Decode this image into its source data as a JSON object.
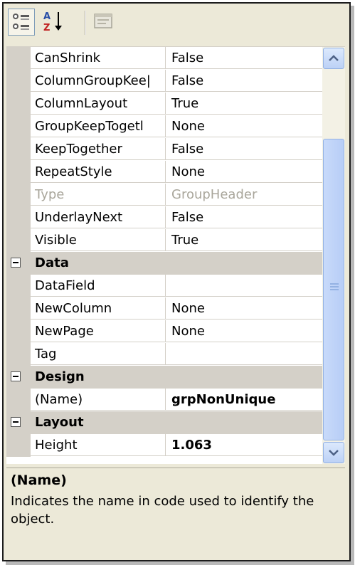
{
  "toolbar": {
    "categorized_icon": "categorized-icon",
    "alphabetical_icon": "alphabetical-sort-icon",
    "property_pages_icon": "property-pages-icon"
  },
  "rows_top": [
    {
      "name": "CanShrink",
      "value": "False"
    },
    {
      "name": "ColumnGroupKee|",
      "value": "False"
    },
    {
      "name": "ColumnLayout",
      "value": "True"
    },
    {
      "name": "GroupKeepTogetl",
      "value": "None"
    },
    {
      "name": "KeepTogether",
      "value": "False"
    },
    {
      "name": "RepeatStyle",
      "value": "None"
    },
    {
      "name": "Type",
      "value": "GroupHeader"
    },
    {
      "name": "UnderlayNext",
      "value": "False"
    },
    {
      "name": "Visible",
      "value": "True"
    }
  ],
  "categories": {
    "data": {
      "label": "Data",
      "rows": [
        {
          "name": "DataField",
          "value": ""
        },
        {
          "name": "NewColumn",
          "value": "None"
        },
        {
          "name": "NewPage",
          "value": "None"
        },
        {
          "name": "Tag",
          "value": ""
        }
      ]
    },
    "design": {
      "label": "Design",
      "rows": [
        {
          "name": "(Name)",
          "value": "grpNonUnique"
        }
      ]
    },
    "layout": {
      "label": "Layout",
      "rows": [
        {
          "name": "Height",
          "value": "1.063"
        }
      ]
    }
  },
  "help": {
    "title": "(Name)",
    "description": "Indicates the name in code used to identify the object."
  },
  "colors": {
    "panel": "#ece9d8",
    "gutter": "#d4d0c8",
    "scrollbar_accent": "#94b2e3"
  }
}
